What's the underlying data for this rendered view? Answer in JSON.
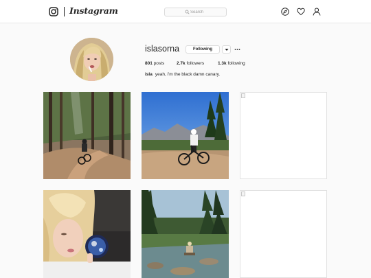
{
  "nav": {
    "brand": "Instagram",
    "search_placeholder": "Search",
    "logo_icon": "instagram-glyph-icon",
    "icons": [
      "compass-icon",
      "heart-icon",
      "person-icon"
    ]
  },
  "profile": {
    "username": "isla​sorna",
    "follow_label": "Following",
    "stats": {
      "posts_count": "801",
      "posts_label": "posts",
      "followers_count": "2.7k",
      "followers_label": "followers",
      "following_count": "1.3k",
      "following_label": "following"
    },
    "bio": {
      "name": "isla",
      "text": "yeah, i'm the black damn canary."
    }
  },
  "posts": [
    {
      "subject": "mountain biker on forest trail",
      "status": "loaded"
    },
    {
      "subject": "cyclist with bike under blue sky",
      "status": "loaded"
    },
    {
      "subject": "image",
      "status": "broken"
    },
    {
      "subject": "blonde woman holding phone",
      "status": "loaded"
    },
    {
      "subject": "person sitting in mountain creek",
      "status": "loaded"
    },
    {
      "subject": "image",
      "status": "broken"
    }
  ],
  "colors": {
    "background": "#fafafa",
    "text": "#262626",
    "border": "#dbdbdb",
    "muted": "#999999"
  }
}
